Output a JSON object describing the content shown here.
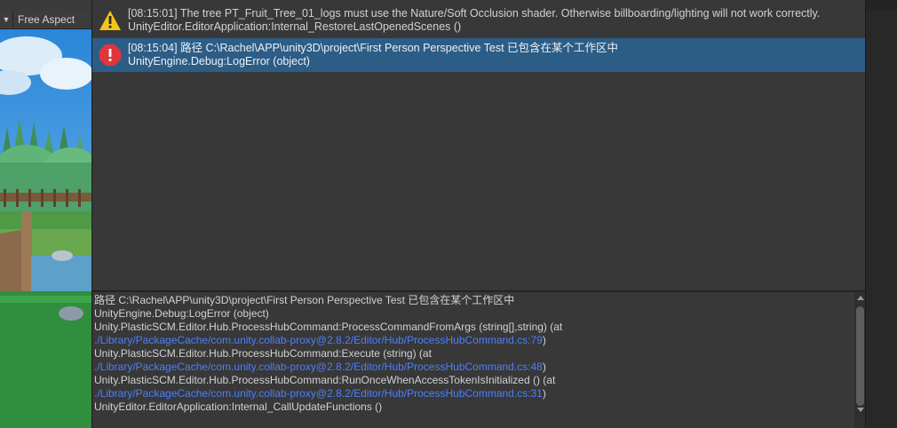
{
  "game_view": {
    "aspect_label": "Free Aspect",
    "dropdown_icon": "triangle-down-icon"
  },
  "console": {
    "entries": [
      {
        "type": "warning",
        "icon": "warning-icon",
        "line1": "[08:15:01] The tree PT_Fruit_Tree_01_logs must use the Nature/Soft Occlusion shader. Otherwise billboarding/lighting will not work correctly.",
        "line2": "UnityEditor.EditorApplication:Internal_RestoreLastOpenedScenes ()",
        "selected": false
      },
      {
        "type": "error",
        "icon": "error-icon",
        "line1": "[08:15:04] 路径 C:\\Rachel\\APP\\unity3D\\project\\First Person Perspective Test 已包含在某个工作区中",
        "line2": "UnityEngine.Debug:LogError (object)",
        "selected": true
      }
    ],
    "details": [
      {
        "text": "路径 C:\\Rachel\\APP\\unity3D\\project\\First Person Perspective Test 已包含在某个工作区中",
        "link": false
      },
      {
        "text": "UnityEngine.Debug:LogError (object)",
        "link": false
      },
      {
        "text": "Unity.PlasticSCM.Editor.Hub.ProcessHubCommand:ProcessCommandFromArgs (string[],string) (at",
        "link": false
      },
      {
        "text": "./Library/PackageCache/com.unity.collab-proxy@2.8.2/Editor/Hub/ProcessHubCommand.cs:79",
        "link": true,
        "suffix": ")"
      },
      {
        "text": "Unity.PlasticSCM.Editor.Hub.ProcessHubCommand:Execute (string) (at",
        "link": false
      },
      {
        "text": "./Library/PackageCache/com.unity.collab-proxy@2.8.2/Editor/Hub/ProcessHubCommand.cs:48",
        "link": true,
        "suffix": ")"
      },
      {
        "text": "Unity.PlasticSCM.Editor.Hub.ProcessHubCommand:RunOnceWhenAccessTokenIsInitialized () (at",
        "link": false
      },
      {
        "text": "./Library/PackageCache/com.unity.collab-proxy@2.8.2/Editor/Hub/ProcessHubCommand.cs:31",
        "link": true,
        "suffix": ")"
      },
      {
        "text": "UnityEditor.EditorApplication:Internal_CallUpdateFunctions ()",
        "link": false
      }
    ]
  },
  "colors": {
    "selected_row": "#2c5d87",
    "link": "#4c7eff",
    "warning": "#f5c518",
    "error": "#e0353a"
  }
}
